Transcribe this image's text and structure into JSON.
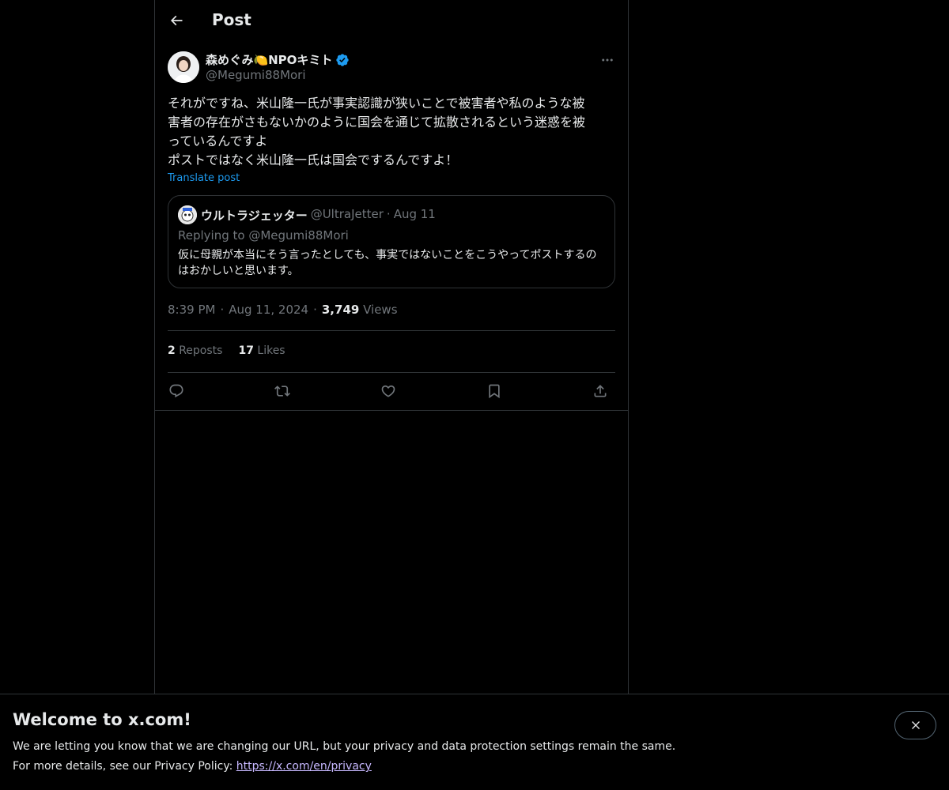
{
  "header": {
    "title": "Post"
  },
  "post": {
    "author_name": "森めぐみ🍋NPOキミト",
    "author_handle": "@Megumi88Mori",
    "text": "それがですね、米山隆一氏が事実認識が狭いことで被害者や私のような被\n害者の存在がさもないかのように国会を通じて拡散されるという迷惑を被\nっているんですよ\nポストではなく米山隆一氏は国会でするんですよ！",
    "translate_label": "Translate post",
    "time": "8:39 PM",
    "date": "Aug 11, 2024",
    "views_count": "3,749",
    "views_label": "Views",
    "reposts_count": "2",
    "reposts_label": "Reposts",
    "likes_count": "17",
    "likes_label": "Likes",
    "separator": "·"
  },
  "quote": {
    "name": "ウルトラジェッター",
    "handle": "@UltraJetter",
    "date": "Aug 11",
    "replying_to": "Replying to @Megumi88Mori",
    "text": "仮に母親が本当にそう言ったとしても、事実ではないことをこうやってポストするのはおかしいと思います。"
  },
  "banner": {
    "title": "Welcome to x.com!",
    "line1": "We are letting you know that we are changing our URL, but your privacy and data protection settings remain the same.",
    "line2_prefix": "For more details, see our Privacy Policy: ",
    "link": "https://x.com/en/privacy"
  },
  "colors": {
    "accent": "#1d9bf0",
    "muted": "#71767b",
    "border": "#2f3336",
    "link_banner": "#c7b8ff"
  }
}
